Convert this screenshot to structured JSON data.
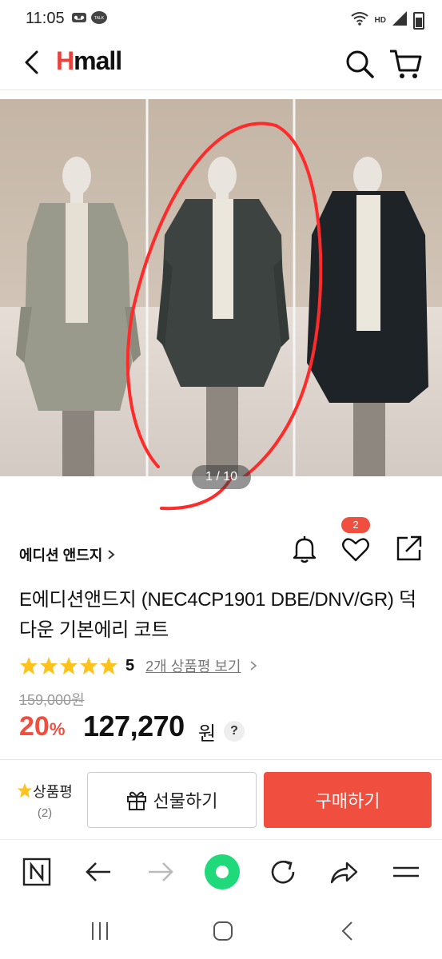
{
  "status": {
    "time": "11:05",
    "network": "HD"
  },
  "header": {
    "logo_h": "H",
    "logo_rest": "mall"
  },
  "gallery": {
    "indicator": "1 / 10"
  },
  "product": {
    "brand": "에디션 앤드지",
    "wishlist_count": "2",
    "title": "E에디션앤드지 (NEC4CP1901 DBE/DNV/GR) 덕다운 기본에리 코트",
    "rating": {
      "score": "5",
      "stars": 5,
      "review_link": "2개 상품평 보기"
    },
    "original_price": "159,000원",
    "discount_rate": "20",
    "discount_unit": "%",
    "price": "127,270",
    "price_unit": "원",
    "help": "?"
  },
  "bottom_bar": {
    "review_label": "상품평",
    "review_count": "(2)",
    "gift_label": "선물하기",
    "buy_label": "구매하기"
  },
  "colors": {
    "accent": "#f04e3e",
    "text": "#111111",
    "green": "#1fd97a"
  },
  "coats": [
    "#9a9a8c",
    "#3c4340",
    "#1e2328"
  ]
}
